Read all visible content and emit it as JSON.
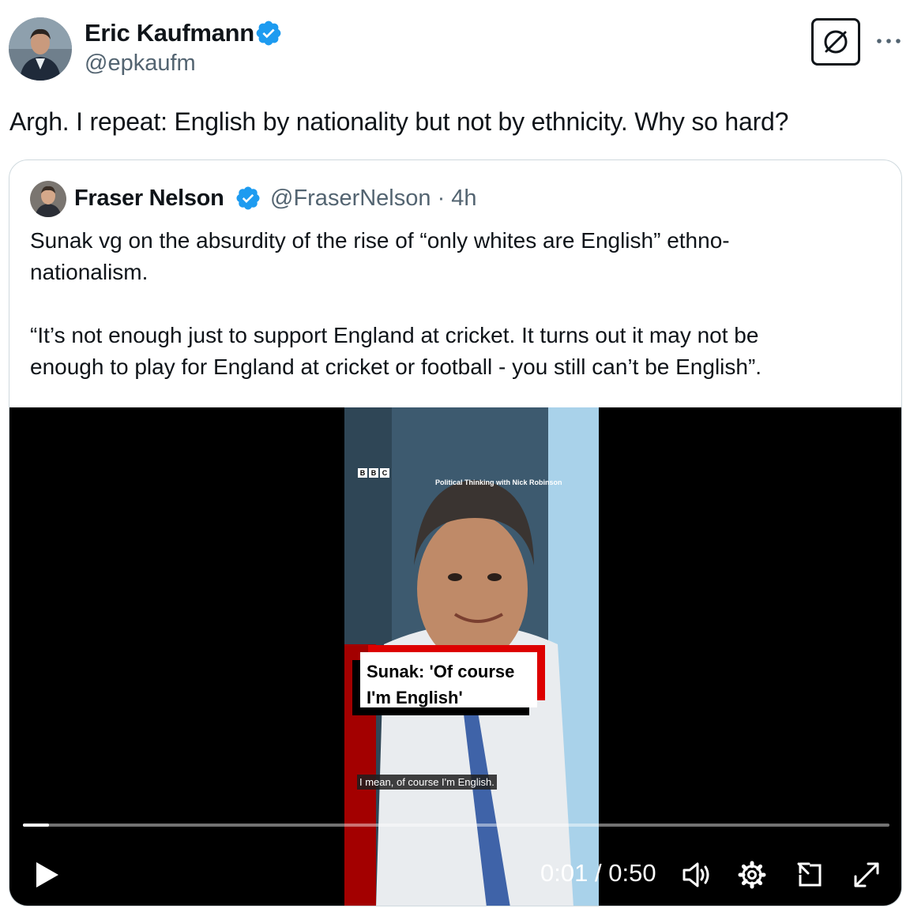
{
  "author": {
    "name": "Eric Kaufmann",
    "handle": "@epkaufm"
  },
  "tweet_text": "Argh. I repeat: English by nationality but not by ethnicity. Why so hard?",
  "quoted": {
    "name": "Fraser Nelson",
    "handle": "@FraserNelson",
    "separator": "·",
    "time": "4h",
    "paragraphs": [
      "Sunak vg on the absurdity of the rise of “only whites are English” ethno-",
      "nationalism.",
      "“It’s not enough just to support England at cricket. It turns out it may not be",
      "enough to play for England at cricket or football - you still can’t be English”."
    ]
  },
  "video": {
    "logo_letters": [
      "B",
      "B",
      "C"
    ],
    "program_title": "Political Thinking with Nick Robinson",
    "caption_line1": "Sunak: 'Of course",
    "caption_line2": "I'm English'",
    "subtitle": "I mean, of course I'm English.",
    "current_time": "0:01",
    "total_time": "0:50",
    "progress_fraction": 0.03
  },
  "icons": {
    "verified": "verified-badge-icon",
    "grok": "grok-icon",
    "more": "more-icon",
    "play": "play-icon",
    "volume": "volume-icon",
    "settings": "settings-gear-icon",
    "pip": "picture-in-picture-icon",
    "fullscreen": "fullscreen-icon"
  },
  "colors": {
    "verified": "#1d9bf0",
    "text": "#0f1419",
    "muted": "#536471",
    "border": "#cfd9de",
    "bbc_red": "#dd0000"
  }
}
